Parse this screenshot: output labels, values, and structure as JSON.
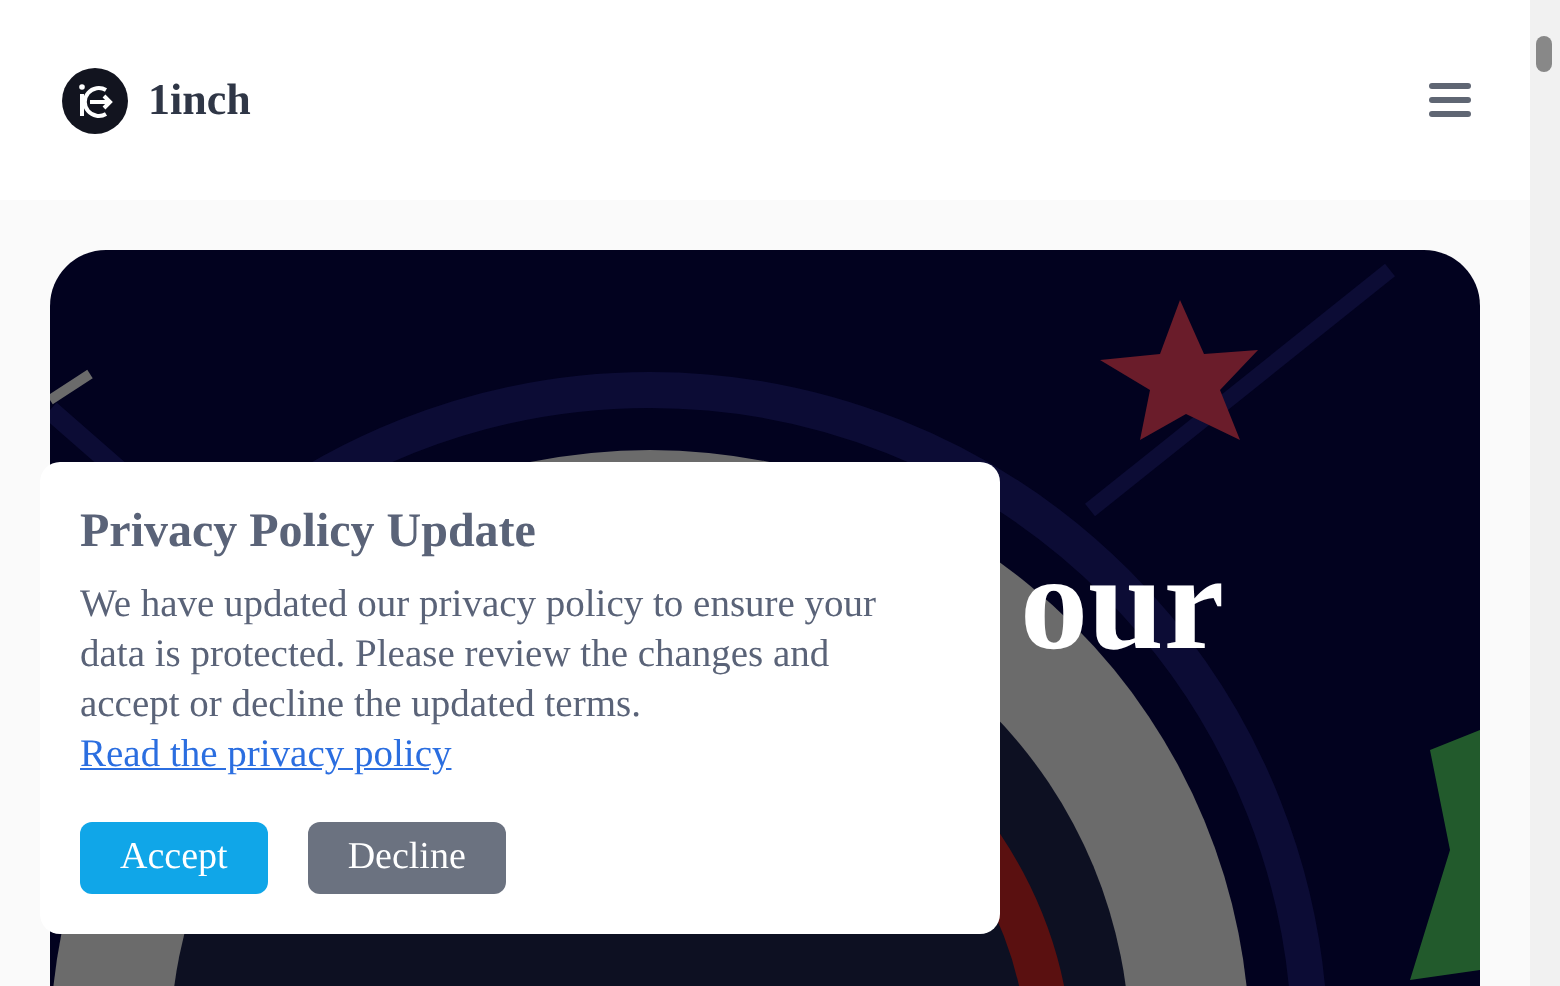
{
  "header": {
    "brand": "1inch"
  },
  "hero": {
    "heading_fragments": [
      "our"
    ]
  },
  "dialog": {
    "title": "Privacy Policy Update",
    "body": "We have updated our privacy policy to ensure your data is protected. Please review the changes and accept or decline the updated terms.",
    "link": "Read the privacy policy",
    "buttons": [
      {
        "label": "Accept",
        "kind": "primary"
      },
      {
        "label": "Decline",
        "kind": "secondary"
      }
    ]
  }
}
